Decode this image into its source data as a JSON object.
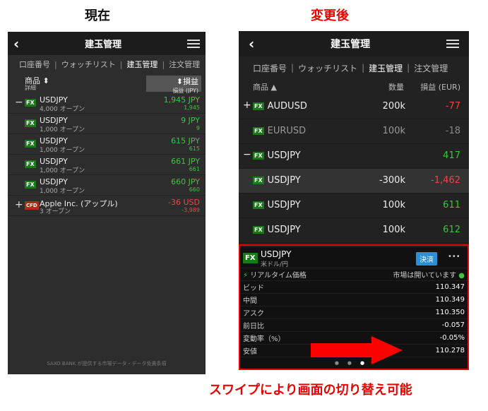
{
  "headings": {
    "current": "現在",
    "after": "変更後",
    "caption": "スワイプにより画面の切り替え可能"
  },
  "left": {
    "title": "建玉管理",
    "tabs": [
      "口座番号",
      "ウォッチリスト",
      "建玉管理",
      "注文管理"
    ],
    "col_product": "商品 ⬍",
    "col_detail": "詳細",
    "col_pl": "⬍損益",
    "col_pl_sub": "損益 (JPY)",
    "rows": [
      {
        "pm": "−",
        "badge": "FX",
        "sym": "USDJPY",
        "sub": "4,000 オープン",
        "v1": "1,945 JPY",
        "v2": "1,945"
      },
      {
        "pm": "",
        "badge": "FX",
        "sym": "USDJPY",
        "sub": "1,000 オープン",
        "v1": "9 JPY",
        "v2": "9"
      },
      {
        "pm": "",
        "badge": "FX",
        "sym": "USDJPY",
        "sub": "1,000 オープン",
        "v1": "615 JPY",
        "v2": "615"
      },
      {
        "pm": "",
        "badge": "FX",
        "sym": "USDJPY",
        "sub": "1,000 オープン",
        "v1": "661 JPY",
        "v2": "661"
      },
      {
        "pm": "",
        "badge": "FX",
        "sym": "USDJPY",
        "sub": "1,000 オープン",
        "v1": "660 JPY",
        "v2": "660"
      },
      {
        "pm": "+",
        "badge": "CFD",
        "sym": "Apple Inc. (アップル)",
        "sub": "3 オープン",
        "v1": "-36 USD",
        "v2": "-3,989"
      }
    ],
    "footer": "SAXO BANK が提供する市場データ・データ免責条項"
  },
  "right": {
    "title": "建玉管理",
    "tabs": [
      "口座番号",
      "ウォッチリスト",
      "建玉管理",
      "注文管理"
    ],
    "col_product": "商品 ▲",
    "col_qty": "数量",
    "col_pl": "損益 (EUR)",
    "rows": [
      {
        "pm": "+",
        "badge": "FX",
        "name": "AUDUSD",
        "qty": "200k",
        "pl": "-77",
        "cls": "red"
      },
      {
        "pm": "",
        "badge": "FX",
        "name": "EURUSD",
        "qty": "100k",
        "pl": "-18",
        "cls": "grey"
      },
      {
        "pm": "−",
        "badge": "FX",
        "name": "USDJPY",
        "qty": "",
        "pl": "417",
        "cls": "green"
      },
      {
        "pm": "",
        "badge": "FX",
        "name": "USDJPY",
        "qty": "-300k",
        "pl": "-1,462",
        "cls": "red"
      },
      {
        "pm": "",
        "badge": "FX",
        "name": "USDJPY",
        "qty": "100k",
        "pl": "611",
        "cls": "green"
      },
      {
        "pm": "",
        "badge": "FX",
        "name": "USDJPY",
        "qty": "100k",
        "pl": "612",
        "cls": "green"
      }
    ],
    "panel": {
      "badge": "FX",
      "sym": "USDJPY",
      "sub": "米ドル/円",
      "settle": "決済",
      "more": "•••",
      "realtime": "リアルタイム価格",
      "market": "市場は開いています",
      "rows": [
        {
          "label": "ビッド",
          "val": "110.347",
          "cls": ""
        },
        {
          "label": "中間",
          "val": "110.349",
          "cls": ""
        },
        {
          "label": "アスク",
          "val": "110.350",
          "cls": ""
        },
        {
          "label": "前日比",
          "val": "-0.057",
          "cls": "red"
        },
        {
          "label": "変動率（%）",
          "val": "-0.05%",
          "cls": "red"
        },
        {
          "label": "安値",
          "val": "110.278",
          "cls": ""
        }
      ]
    }
  },
  "colors": {
    "accent_red": "#e00000",
    "green": "#3ec43e",
    "fx_badge": "#1a7a1a",
    "cfd_badge": "#b52a14",
    "settle_button": "#2a8fd8"
  }
}
